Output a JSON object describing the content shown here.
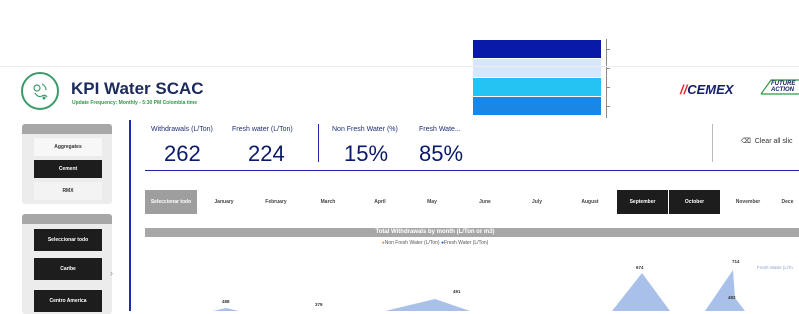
{
  "header": {
    "title": "KPI Water SCAC",
    "subtitle": "Update Frequency: Monthly - 5:30 PM Colombia time",
    "brand": "CEMEX",
    "brand2": "FUTURE IN ACTION"
  },
  "segment_slicer": {
    "items": [
      "Aggregates",
      "Cement",
      "RMX"
    ],
    "selected": "Cement"
  },
  "region_slicer": {
    "items": [
      "Seleccionar todo",
      "Caribe",
      "Centro America"
    ]
  },
  "kpis": [
    {
      "label": "Withdrawals (L/Ton)",
      "value": "262"
    },
    {
      "label": "Fresh water (L/Ton)",
      "value": "224"
    },
    {
      "label": "Non Fresh Water (%)",
      "value": "15%"
    },
    {
      "label": "Fresh Wate...",
      "value": "85%"
    }
  ],
  "clear_button": "Clear all slic",
  "months": {
    "select_all": "Seleccionar todo",
    "items": [
      "January",
      "February",
      "March",
      "April",
      "May",
      "June",
      "July",
      "August",
      "September",
      "October",
      "November",
      "Dece"
    ],
    "selected": [
      "September",
      "October"
    ]
  },
  "chart_data": {
    "type": "area",
    "title": "Total Withdrawals by month (L/Ton or m3)",
    "legend": [
      "Non Fresh Water (L/Ton)",
      "Fresh Water (L/Ton)"
    ],
    "series_label": "Fresh Water (L/To",
    "data_labels": [
      "488",
      "379",
      "491",
      "674",
      "714",
      "483"
    ],
    "colors": {
      "fresh": "#a9c1ea",
      "non_fresh": "#f08a2c",
      "fresh_dot": "#1f5fd8"
    }
  },
  "colors": {
    "swatches": [
      "#0a1aa8",
      "#d7e6fb",
      "#25c2f4",
      "#1a86e6"
    ],
    "accent": "#1f2ba8",
    "selected": "#1d1d1d"
  }
}
